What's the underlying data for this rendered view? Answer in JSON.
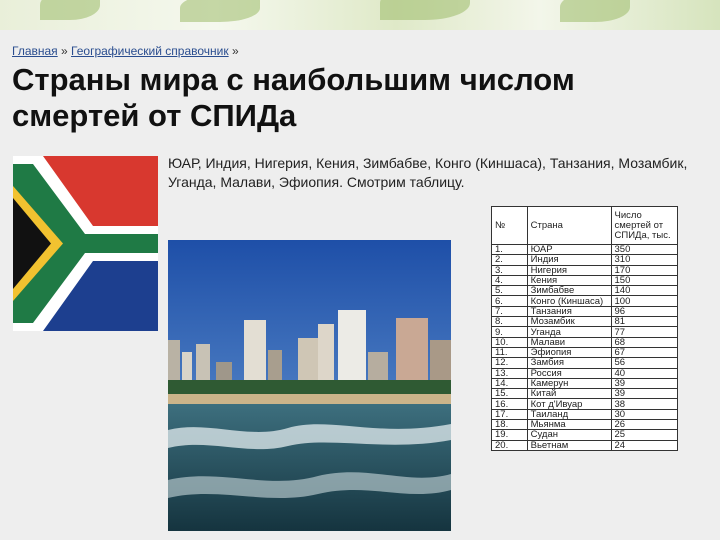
{
  "breadcrumb": {
    "home": "Главная",
    "sep1": " » ",
    "section": "Географический справочник",
    "sep2": " »"
  },
  "page_title": "Страны мира с наибольшим числом смертей от СПИДа",
  "intro_text": "ЮАР, Индия, Нигерия, Кения, Зимбабве, Конго (Киншаса), Танзания, Мозамбик, Уганда, Малави, Эфиопия. Смотрим таблицу.",
  "table": {
    "headers": [
      "№",
      "Страна",
      "Число смертей от СПИДа, тыс."
    ],
    "rows": [
      [
        "1.",
        "ЮАР",
        "350"
      ],
      [
        "2.",
        "Индия",
        "310"
      ],
      [
        "3.",
        "Нигерия",
        "170"
      ],
      [
        "4.",
        "Кения",
        "150"
      ],
      [
        "5.",
        "Зимбабве",
        "140"
      ],
      [
        "6.",
        "Конго (Киншаса)",
        "100"
      ],
      [
        "7.",
        "Танзания",
        "96"
      ],
      [
        "8.",
        "Мозамбик",
        "81"
      ],
      [
        "9.",
        "Уганда",
        "77"
      ],
      [
        "10.",
        "Малави",
        "68"
      ],
      [
        "11.",
        "Эфиопия",
        "67"
      ],
      [
        "12.",
        "Замбия",
        "56"
      ],
      [
        "13.",
        "Россия",
        "40"
      ],
      [
        "14.",
        "Камерун",
        "39"
      ],
      [
        "15.",
        "Китай",
        "39"
      ],
      [
        "16.",
        "Кот д'Ивуар",
        "38"
      ],
      [
        "17.",
        "Таиланд",
        "30"
      ],
      [
        "18.",
        "Мьянма",
        "26"
      ],
      [
        "19.",
        "Судан",
        "25"
      ],
      [
        "20.",
        "Вьетнам",
        "24"
      ]
    ]
  },
  "colors": {
    "flag_green": "#1f7a45",
    "flag_red": "#d8382f",
    "flag_blue": "#1d3f8f",
    "flag_yellow": "#f2c230",
    "link": "#2a4d8f"
  }
}
